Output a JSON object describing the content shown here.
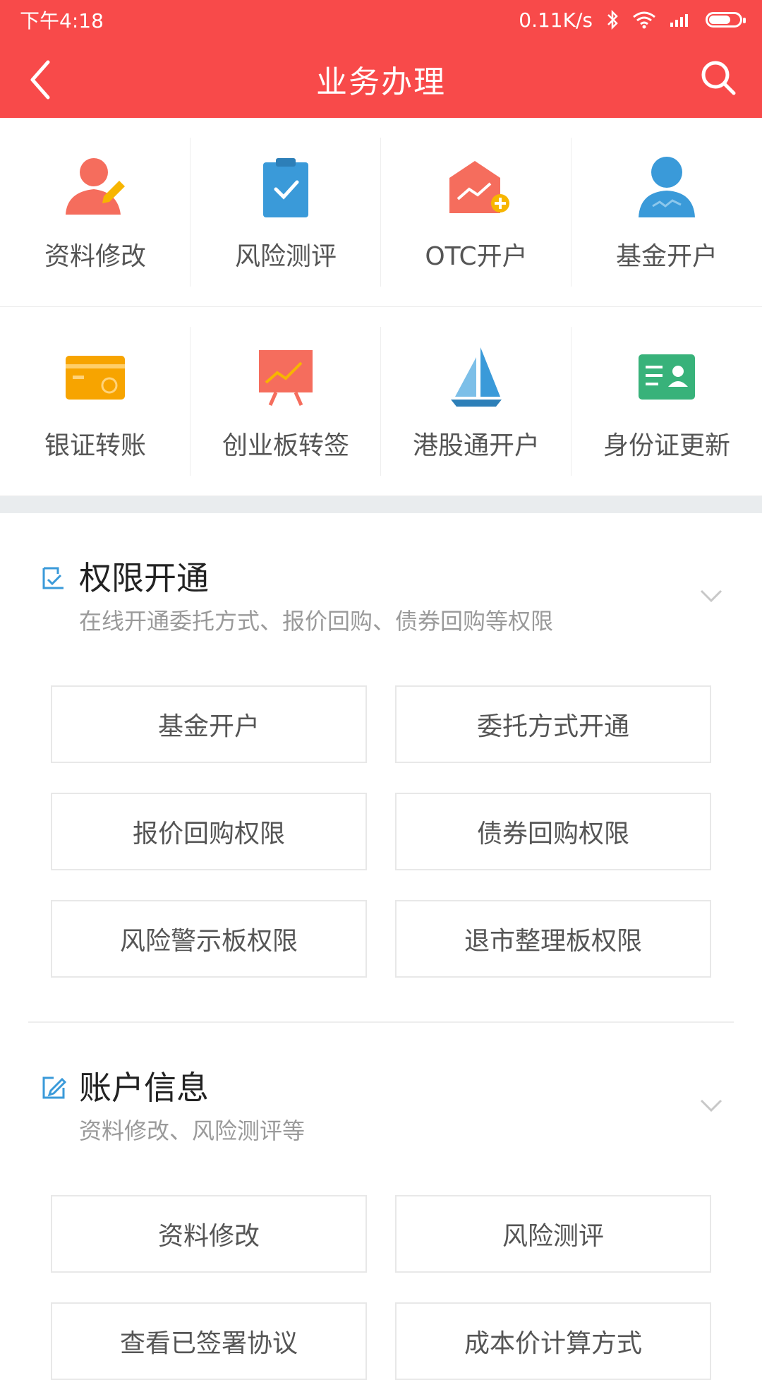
{
  "status": {
    "time": "下午4:18",
    "speed": "0.11K/s",
    "icons": [
      "bluetooth-icon",
      "wifi-icon",
      "signal-icon",
      "battery-icon"
    ]
  },
  "header": {
    "title": "业务办理",
    "back_icon": "chevron-left-icon",
    "search_icon": "search-icon"
  },
  "grid": [
    [
      {
        "label": "资料修改",
        "icon": "person-edit-icon"
      },
      {
        "label": "风险测评",
        "icon": "clipboard-check-icon"
      },
      {
        "label": "OTC开户",
        "icon": "envelope-plus-icon"
      },
      {
        "label": "基金开户",
        "icon": "user-chart-icon"
      }
    ],
    [
      {
        "label": "银证转账",
        "icon": "card-refresh-icon"
      },
      {
        "label": "创业板转签",
        "icon": "presentation-chart-icon"
      },
      {
        "label": "港股通开户",
        "icon": "sail-icon"
      },
      {
        "label": "身份证更新",
        "icon": "id-card-icon"
      }
    ]
  ],
  "sections": [
    {
      "title": "权限开通",
      "subtitle": "在线开通委托方式、报价回购、债券回购等权限",
      "buttons": [
        "基金开户",
        "委托方式开通",
        "报价回购权限",
        "债券回购权限",
        "风险警示板权限",
        "退市整理板权限"
      ]
    },
    {
      "title": "账户信息",
      "subtitle": "资料修改、风险测评等",
      "buttons": [
        "资料修改",
        "风险测评",
        "查看已签署协议",
        "成本价计算方式"
      ]
    }
  ],
  "colors": {
    "brand_red": "#f84a4a",
    "accent_blue": "#3a9ad9",
    "orange": "#f7a400",
    "coral": "#f56d5d",
    "green": "#38b27a"
  }
}
